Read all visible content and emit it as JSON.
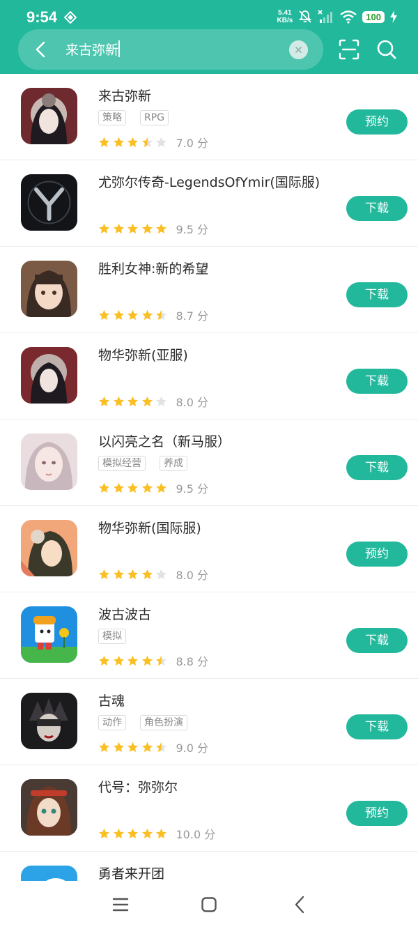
{
  "status_bar": {
    "time": "9:54",
    "net_speed_value": "5.41",
    "net_speed_unit": "KB/s",
    "battery": "100"
  },
  "search": {
    "query": "来古弥新"
  },
  "colors": {
    "accent": "#22b89c",
    "star": "#fbbf24",
    "star_empty": "#e2e2e2"
  },
  "apps": [
    {
      "name": "来古弥新",
      "tags": [
        "策略",
        "RPG"
      ],
      "rating": 3.5,
      "score": "7.0 分",
      "button": "预约"
    },
    {
      "name": "尤弥尔传奇-LegendsOfYmir(国际服)",
      "tags": [],
      "rating": 5,
      "score": "9.5 分",
      "button": "下载"
    },
    {
      "name": "胜利女神:新的希望",
      "tags": [],
      "rating": 4.5,
      "score": "8.7 分",
      "button": "下载"
    },
    {
      "name": "物华弥新(亚服)",
      "tags": [],
      "rating": 4,
      "score": "8.0 分",
      "button": "下载"
    },
    {
      "name": "以闪亮之名（新马服）",
      "tags": [
        "模拟经营",
        "养成"
      ],
      "rating": 5,
      "score": "9.5 分",
      "button": "下载"
    },
    {
      "name": "物华弥新(国际服)",
      "tags": [],
      "rating": 4,
      "score": "8.0 分",
      "button": "预约"
    },
    {
      "name": "波古波古",
      "tags": [
        "模拟"
      ],
      "rating": 4.5,
      "score": "8.8 分",
      "button": "下载"
    },
    {
      "name": "古魂",
      "tags": [
        "动作",
        "角色扮演"
      ],
      "rating": 4.5,
      "score": "9.0 分",
      "button": "下载"
    },
    {
      "name": "代号：弥弥尔",
      "tags": [],
      "rating": 5,
      "score": "10.0 分",
      "button": "预约"
    },
    {
      "name": "勇者来开团",
      "tags": [],
      "rating": 0,
      "score": "",
      "button": ""
    }
  ]
}
